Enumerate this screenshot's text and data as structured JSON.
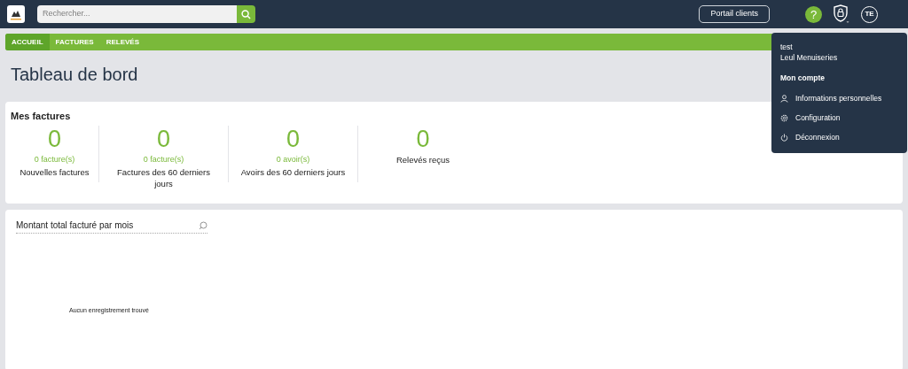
{
  "header": {
    "search": {
      "placeholder": "Rechercher..."
    },
    "portal_button": "Portail clients",
    "help": "?",
    "avatar": "TE"
  },
  "nav": [
    {
      "label": "ACCUEIL",
      "selected": true
    },
    {
      "label": "FACTURES",
      "selected": false
    },
    {
      "label": "RELEVÉS",
      "selected": false
    }
  ],
  "page_title": "Tableau de bord",
  "invoices_card": {
    "title": "Mes factures",
    "stats": [
      {
        "value": "0",
        "sub": "0 facture(s)",
        "label": "Nouvelles factures"
      },
      {
        "value": "0",
        "sub": "0 facture(s)",
        "label": "Factures des 60 derniers jours"
      },
      {
        "value": "0",
        "sub": "0 avoir(s)",
        "label": "Avoirs des 60 derniers jours"
      },
      {
        "value": "0",
        "label": "Relevés reçus"
      }
    ]
  },
  "chart_card": {
    "title": "Montant total facturé par mois",
    "empty_message": "Aucun enregistrement trouvé"
  },
  "account_menu": {
    "user": "test",
    "company": "Leul Menuiseries",
    "section": "Mon compte",
    "items": [
      {
        "kind": "user",
        "label": "Informations personnelles"
      },
      {
        "kind": "gear",
        "label": "Configuration"
      },
      {
        "kind": "power",
        "label": "Déconnexion"
      }
    ]
  }
}
